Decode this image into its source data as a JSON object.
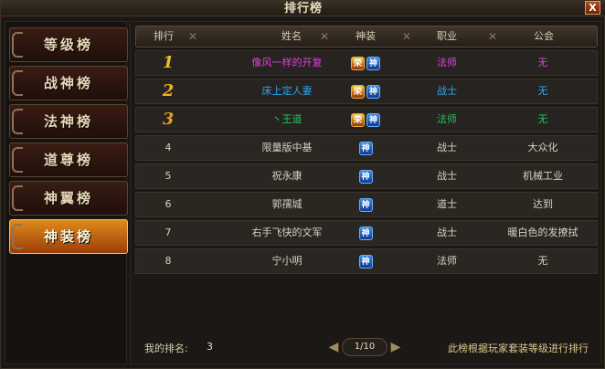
{
  "window": {
    "title": "排行榜",
    "close_label": "X"
  },
  "sidebar": {
    "tabs": [
      {
        "label": "等级榜",
        "active": false
      },
      {
        "label": "战神榜",
        "active": false
      },
      {
        "label": "法神榜",
        "active": false
      },
      {
        "label": "道尊榜",
        "active": false
      },
      {
        "label": "神翼榜",
        "active": false
      },
      {
        "label": "神装榜",
        "active": true
      }
    ]
  },
  "table": {
    "headers": [
      "排行",
      "姓名",
      "神装",
      "职业",
      "公会"
    ],
    "rows": [
      {
        "rank": "1",
        "name": "像风一样的开复",
        "badges": [
          "荣",
          "神"
        ],
        "job": "法师",
        "guild": "无",
        "color": "#e040e0"
      },
      {
        "rank": "2",
        "name": "床上定人妻",
        "badges": [
          "荣",
          "神"
        ],
        "job": "战士",
        "guild": "无",
        "color": "#2aa8f0"
      },
      {
        "rank": "3",
        "name": "丶王道",
        "badges": [
          "荣",
          "神"
        ],
        "job": "法师",
        "guild": "无",
        "color": "#28c060"
      },
      {
        "rank": "4",
        "name": "限量版中基",
        "badges": [
          "神"
        ],
        "job": "战士",
        "guild": "大众化",
        "color": "#d8d0c0"
      },
      {
        "rank": "5",
        "name": "祝永康",
        "badges": [
          "神"
        ],
        "job": "战士",
        "guild": "机械工业",
        "color": "#d8d0c0"
      },
      {
        "rank": "6",
        "name": "郭孺城",
        "badges": [
          "神"
        ],
        "job": "道士",
        "guild": "达到",
        "color": "#d8d0c0"
      },
      {
        "rank": "7",
        "name": "右手飞快的文军",
        "badges": [
          "神"
        ],
        "job": "战士",
        "guild": "暖白色的发撩拭",
        "color": "#d8d0c0"
      },
      {
        "rank": "8",
        "name": "宁小明",
        "badges": [
          "神"
        ],
        "job": "法师",
        "guild": "无",
        "color": "#d8d0c0"
      }
    ]
  },
  "footer": {
    "my_rank_label": "我的排名:",
    "my_rank_value": "3",
    "page": "1/10",
    "prev_icon": "◀",
    "next_icon": "▶",
    "note": "此榜根据玩家套装等级进行排行"
  },
  "colors": {
    "rank1": "#f0c020",
    "rank2": "#f0b020",
    "rank3": "#e0a020",
    "accent": "#e08a1c"
  }
}
